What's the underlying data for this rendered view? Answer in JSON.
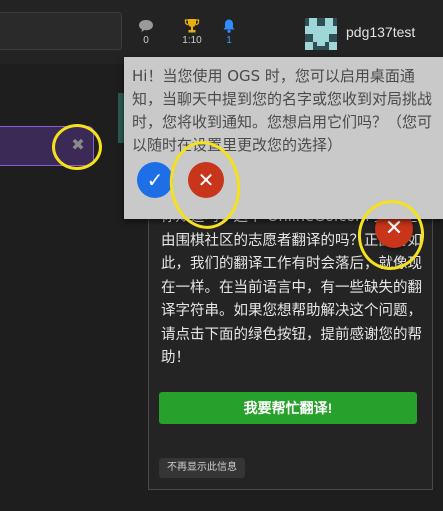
{
  "header": {
    "stats": [
      {
        "icon": "chat-icon",
        "value": "0"
      },
      {
        "icon": "trophy-icon",
        "value": "1:10"
      },
      {
        "icon": "bell-icon",
        "value": "1"
      }
    ],
    "username": "pdg137test"
  },
  "left_panel": {
    "close_glyph": "✖"
  },
  "notification": {
    "text": "Hi！当您使用 OGS 时，您可以启用桌面通知，当聊天中提到您的名字或您收到对局挑战时，您将收到通知。您想启用它们吗？（您可以随时在设置里更改您的选择）",
    "yes_glyph": "✓",
    "no_glyph": "✕"
  },
  "translate_card": {
    "text": "你知道吗，这个 OnlineGo.com 完全是由围棋社区的志愿者翻译的吗？正因为如此，我们的翻译工作有时会落后，就像现在一样。在当前语言中，有一些缺失的翻译字符串。如果您想帮助解决这个问题，请点击下面的绿色按钮，提前感谢您的帮助！",
    "help_button": "我要帮忙翻译!",
    "no_show_button": "不再显示此信息",
    "close_glyph": "✕"
  },
  "colors": {
    "accent_blue": "#1e6fe6",
    "danger_red": "#c8351a",
    "success_green": "#27a12b",
    "annotation_yellow": "#f5e11c"
  }
}
